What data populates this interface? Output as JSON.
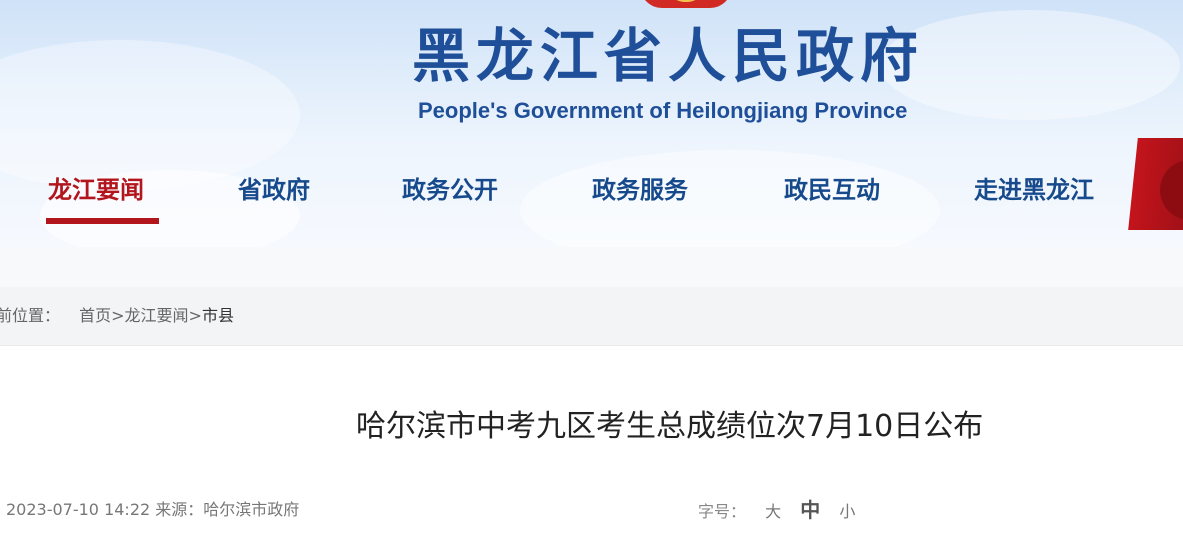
{
  "site": {
    "title_cn": "黑龙江省人民政府",
    "title_en": "People's Government of Heilongjiang Province"
  },
  "nav": {
    "items": [
      {
        "label": "龙江要闻",
        "active": true
      },
      {
        "label": "省政府",
        "active": false
      },
      {
        "label": "政务公开",
        "active": false
      },
      {
        "label": "政务服务",
        "active": false
      },
      {
        "label": "政民互动",
        "active": false
      },
      {
        "label": "走进黑龙江",
        "active": false
      }
    ],
    "active_color": "#b3151c",
    "color": "#164a8c"
  },
  "breadcrumb": {
    "prefix": "前位置：",
    "items": [
      "首页",
      "龙江要闻",
      "市县"
    ],
    "separator": ">"
  },
  "article": {
    "title": "哈尔滨市中考九区考生总成绩位次7月10日公布",
    "date": "2023-07-10 14:22",
    "source_label": "来源：",
    "source": "哈尔滨市政府"
  },
  "font_size": {
    "label": "字号：",
    "options": [
      "大",
      "中",
      "小"
    ]
  },
  "icons": [
    "national-emblem-icon",
    "ribbon-decoration"
  ]
}
